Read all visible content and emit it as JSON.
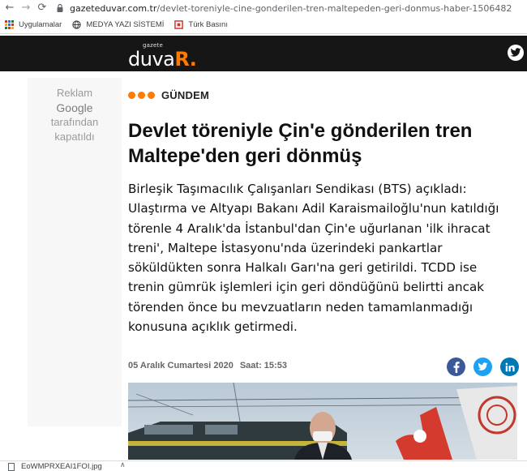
{
  "browser": {
    "url_host": "gazeteduvar.com.tr",
    "url_path": "/devlet-toreniyle-cine-gonderilen-tren-maltepeden-geri-donmus-haber-1506482",
    "bookmarks": [
      {
        "label": "Uygulamalar",
        "icon": "apps-grid-icon"
      },
      {
        "label": "MEDYA YAZI SİSTEMİ",
        "icon": "globe-icon"
      },
      {
        "label": "Türk Basını",
        "icon": "tb-favicon-icon"
      }
    ]
  },
  "site": {
    "logo_small": "gazete",
    "logo_main": "duva",
    "logo_accent": "R.",
    "brand_color": "#ff7a00"
  },
  "ad": {
    "line1": "Reklam",
    "line2": "Google",
    "line3": "tarafından",
    "line4": "kapatıldı"
  },
  "article": {
    "category": "GÜNDEM",
    "headline_line1": "Devlet töreniyle Çin'e gönderilen tren",
    "headline_line2": "Maltepe'den geri dönmüş",
    "summary": [
      "Birleşik Taşımacılık Çalışanları Sendikası (BTS) açıkladı:",
      "Ulaştırma ve Altyapı Bakanı Adil Karaismailoğlu'nun katıldığı",
      "törenle 4 Aralık'da İstanbul'dan Çin'e uğurlanan 'ilk ihracat",
      "treni', Maltepe İstasyonu'nda üzerindeki pankartlar",
      "söküldükten sonra Halkalı Garı'na geri getirildi. TCDD ise",
      "trenin gümrük işlemleri için geri döndüğünü belirtti ancak",
      "törenden önce bu mevzuatların neden tamamlanmadığı",
      "konusuna açıklık getirmedi."
    ],
    "date": "05 Aralık Cumartesi 2020",
    "time_label": "Saat: 15:53"
  },
  "share": {
    "facebook_color": "#3b5998",
    "twitter_color": "#1da1f2",
    "linkedin_color": "#0077b5"
  },
  "download": {
    "filename": "EoWMPRXEAI1FOI.jpg"
  }
}
